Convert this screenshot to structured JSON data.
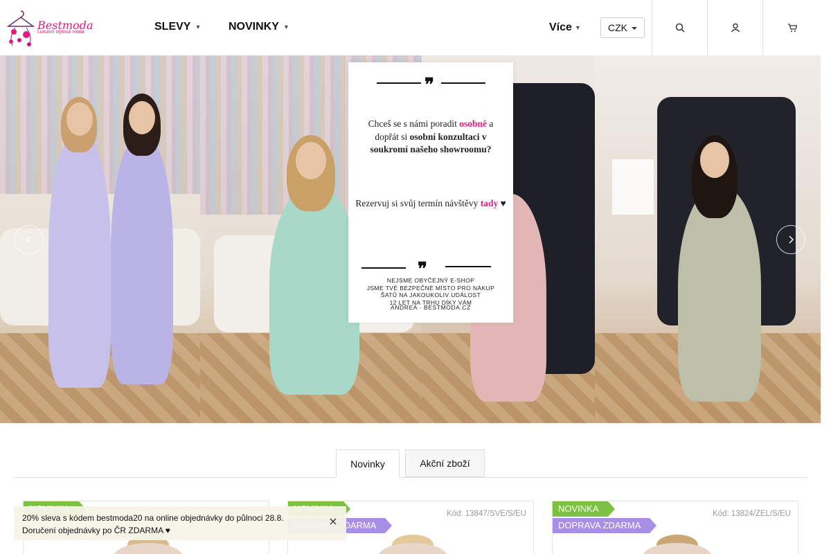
{
  "header": {
    "logo": {
      "name": "Bestmoda",
      "tagline": "Luxusní stylová móda"
    },
    "nav": [
      {
        "label": "SLEVY"
      },
      {
        "label": "NOVINKY"
      }
    ],
    "more_label": "Více",
    "currency": "CZK",
    "icons": [
      "search-icon",
      "user-icon",
      "cart-icon"
    ]
  },
  "hero": {
    "promo": {
      "question_parts": [
        "Chceš se s námi poradit ",
        "osobně",
        " a dopřát si ",
        "osobní konzultaci v soukromí našeho showroomu?"
      ],
      "reserve_parts": [
        "Rezervuj si svůj termín návštěvy ",
        "tady",
        " ♥"
      ],
      "footer_lines": [
        "NEJSME OBYČEJNÝ E-SHOP",
        "JSME TVÉ BEZPEČNÉ MÍSTO PRO NÁKUP",
        "ŠATŮ NA JAKOUKOLIV UDÁLOST",
        "12 LET NA TRHU DÍKY VÁM"
      ],
      "signature": "ANDREA · BESTMODA.CZ"
    },
    "icons": [
      "arrow-left-icon",
      "arrow-right-icon"
    ]
  },
  "tabs": [
    {
      "label": "Novinky",
      "active": true
    },
    {
      "label": "Akční zboží",
      "active": false
    }
  ],
  "products": [
    {
      "badges": [
        "NOVINKA"
      ],
      "code_label": "",
      "code": ""
    },
    {
      "badges": [
        "NOVINKA",
        "DOPRAVA ZDARMA"
      ],
      "code_label": "Kód:",
      "code": "13847/SVE/S/EU"
    },
    {
      "badges": [
        "NOVINKA",
        "DOPRAVA ZDARMA"
      ],
      "code_label": "Kód:",
      "code": "13824/ZEL/S/EU"
    }
  ],
  "notice": {
    "text": "20% sleva s kódem bestmoda20 na online objednávky do půlnoci 28.8. Doručení objednávky po ČR ZDARMA ♥"
  },
  "colors": {
    "brand_pink": "#e5197f",
    "badge_green": "#7cc142",
    "badge_purple": "#a88ee6"
  }
}
